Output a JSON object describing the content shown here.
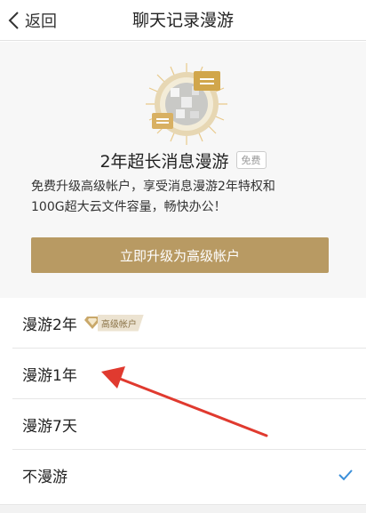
{
  "header": {
    "back_label": "返回",
    "title": "聊天记录漫游"
  },
  "promo": {
    "emblem_icon": "message-roaming-emblem-icon",
    "title": "2年超长消息漫游",
    "badge": "免费",
    "description_line1": "免费升级高级帐户，享受消息漫游2年特权和",
    "description_line2": "100G超大云文件容量，畅快办公！",
    "upgrade_button": "立即升级为高级帐户"
  },
  "options": [
    {
      "label": "漫游2年",
      "tag": "高级帐户",
      "selected": false
    },
    {
      "label": "漫游1年",
      "selected": false
    },
    {
      "label": "漫游7天",
      "selected": false
    },
    {
      "label": "不漫游",
      "selected": true
    }
  ],
  "colors": {
    "accent_gold": "#b89a63",
    "check_blue": "#3b8fd9",
    "annotation_red": "#e03a2f"
  }
}
